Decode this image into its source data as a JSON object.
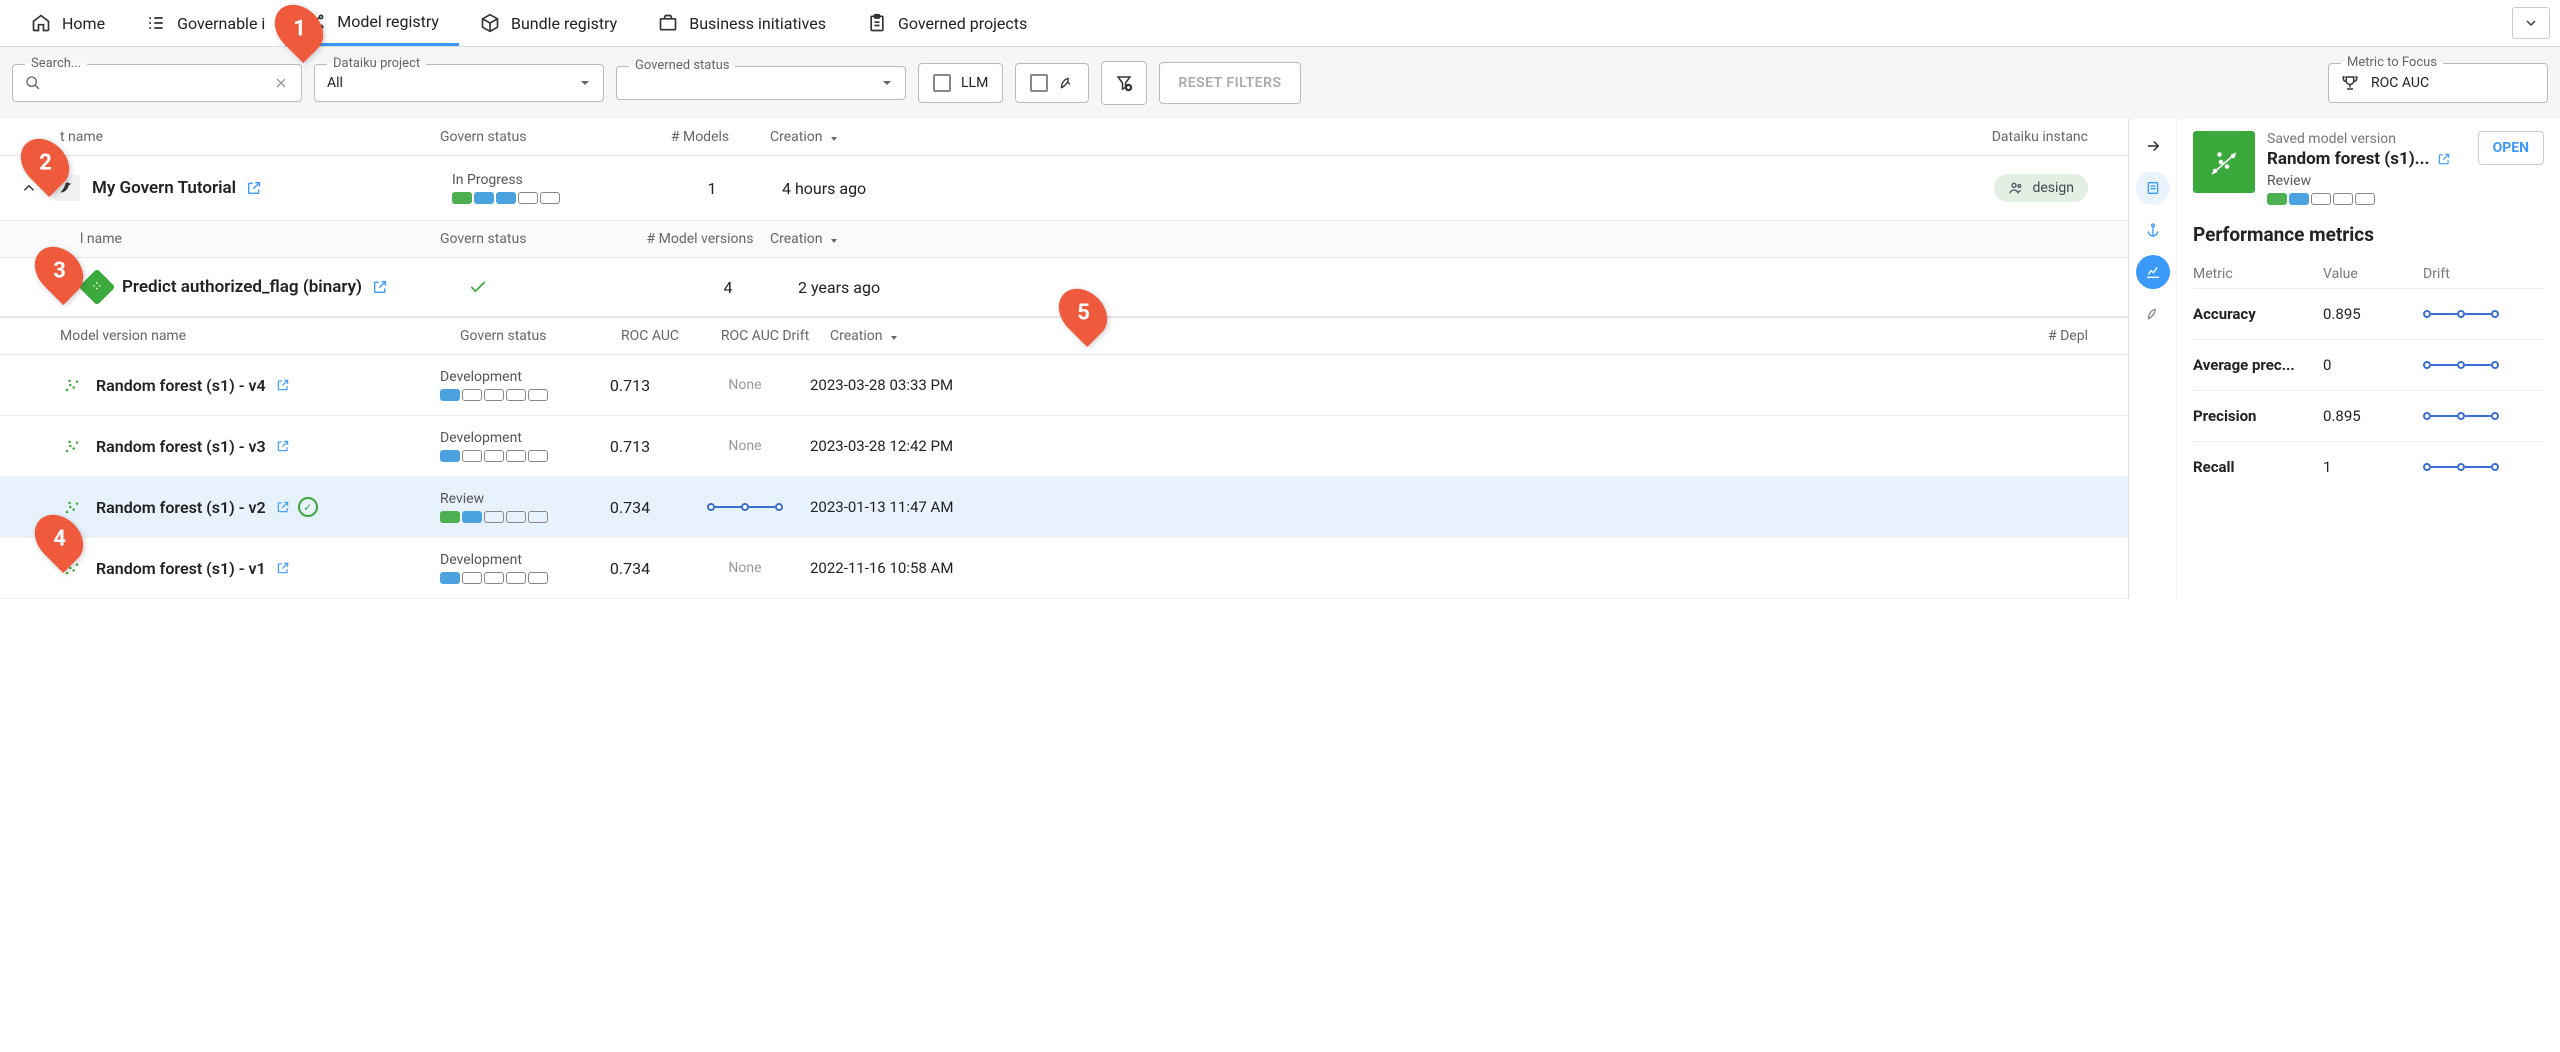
{
  "nav": {
    "home": "Home",
    "governable": "Governable i",
    "model_registry": "Model registry",
    "bundle_registry": "Bundle registry",
    "business": "Business initiatives",
    "governed": "Governed projects"
  },
  "filters": {
    "search_legend": "Search...",
    "project_legend": "Dataiku project",
    "project_value": "All",
    "status_legend": "Governed status",
    "llm_label": "LLM",
    "reset": "RESET FILTERS",
    "metric_legend": "Metric to Focus",
    "metric_value": "ROC AUC"
  },
  "project_header": {
    "name": "t name",
    "status": "Govern status",
    "count": "# Models",
    "created": "Creation",
    "instance": "Dataiku instanc"
  },
  "project": {
    "name": "My Govern Tutorial",
    "status": "In Progress",
    "count": "1",
    "created": "4 hours ago",
    "instance": "design"
  },
  "model_header": {
    "name": "l name",
    "status": "Govern status",
    "count": "# Model versions",
    "created": "Creation"
  },
  "model": {
    "name": "Predict authorized_flag (binary)",
    "count": "4",
    "created": "2 years ago"
  },
  "version_header": {
    "name": "Model version name",
    "status": "Govern status",
    "roc": "ROC AUC",
    "drift": "ROC AUC Drift",
    "created": "Creation",
    "deploy": "# Depl"
  },
  "versions": [
    {
      "name": "Random forest (s1) - v4",
      "status": "Development",
      "roc": "0.713",
      "drift": "None",
      "created": "2023-03-28 03:33 PM",
      "selected": false,
      "ring": false,
      "drift_viz": false
    },
    {
      "name": "Random forest (s1) - v3",
      "status": "Development",
      "roc": "0.713",
      "drift": "None",
      "created": "2023-03-28 12:42 PM",
      "selected": false,
      "ring": false,
      "drift_viz": false
    },
    {
      "name": "Random forest (s1) - v2",
      "status": "Review",
      "roc": "0.734",
      "drift": "",
      "created": "2023-01-13 11:47 AM",
      "selected": true,
      "ring": true,
      "drift_viz": true
    },
    {
      "name": "Random forest (s1) - v1",
      "status": "Development",
      "roc": "0.734",
      "drift": "None",
      "created": "2022-11-16 10:58 AM",
      "selected": false,
      "ring": false,
      "drift_viz": false
    }
  ],
  "side": {
    "breadcrumb": "Saved model version",
    "title": "Random forest (s1)...",
    "sublabel": "Review",
    "open": "OPEN",
    "h2": "Performance metrics",
    "metric_header": {
      "name": "Metric",
      "value": "Value",
      "drift": "Drift"
    },
    "metrics": [
      {
        "name": "Accuracy",
        "value": "0.895"
      },
      {
        "name": "Average prec...",
        "value": "0"
      },
      {
        "name": "Precision",
        "value": "0.895"
      },
      {
        "name": "Recall",
        "value": "1"
      }
    ]
  },
  "callouts": [
    "1",
    "2",
    "3",
    "4",
    "5"
  ]
}
